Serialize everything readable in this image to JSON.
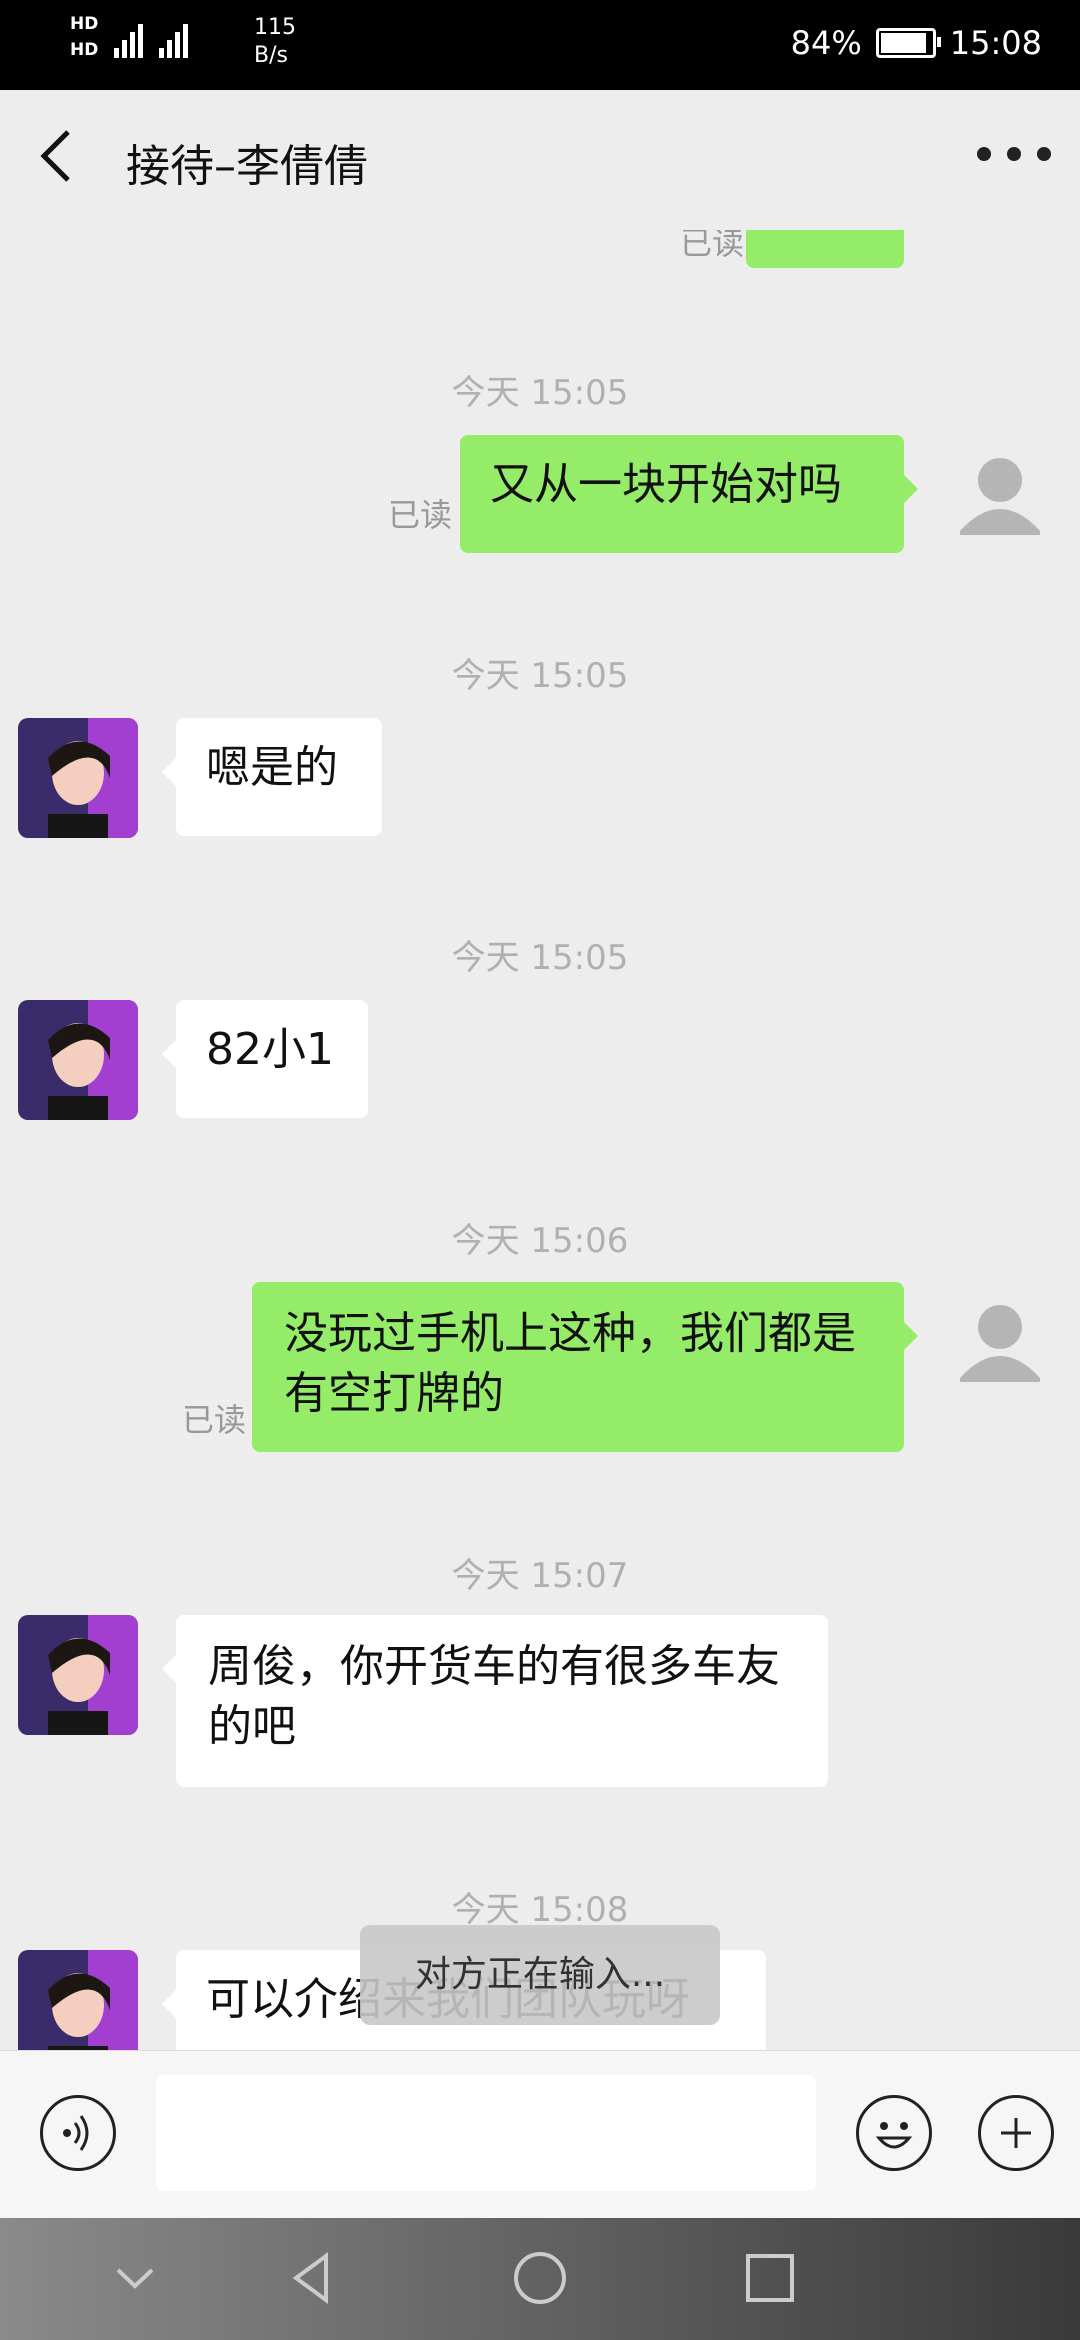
{
  "status_bar": {
    "hd1": "HD",
    "hd2": "HD",
    "net_speed_value": "115",
    "net_speed_unit": "B/s",
    "battery": "84%",
    "time": "15:08"
  },
  "header": {
    "title": "接待–李倩倩"
  },
  "messages": [
    {
      "timestamp": "今天 15:05",
      "side": "right",
      "text": "又从一块开始对吗",
      "read": "已读"
    },
    {
      "timestamp": "今天 15:05",
      "side": "left",
      "text": "嗯是的"
    },
    {
      "timestamp": "今天 15:05",
      "side": "left",
      "text": "82小1"
    },
    {
      "timestamp": "今天 15:06",
      "side": "right",
      "text": "没玩过手机上这种，我们都是有空打牌的",
      "read": "已读"
    },
    {
      "timestamp": "今天 15:07",
      "side": "left",
      "text": "周俊，你开货车的有很多车友的吧"
    },
    {
      "timestamp": "今天 15:08",
      "side": "left",
      "text": "可以介绍来我们团队玩呀"
    }
  ],
  "typing_toast": "对方正在输入...",
  "input": {
    "placeholder": ""
  }
}
